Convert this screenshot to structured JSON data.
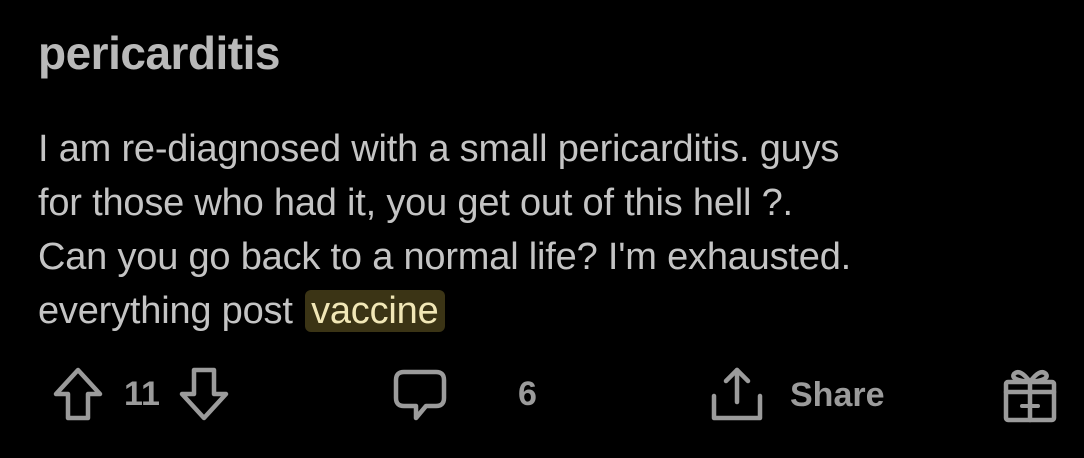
{
  "post": {
    "title": "pericarditis",
    "body_lines": [
      "I am re-diagnosed with a small pericarditis. guys",
      "for those who had it, you get out of this hell ?.",
      "Can you go back to a normal life? I'm exhausted."
    ],
    "last_line_prefix": "everything post",
    "highlighted_word": "vaccine"
  },
  "actions": {
    "upvote_icon": "arrow-up-icon",
    "vote_count": "11",
    "downvote_icon": "arrow-down-icon",
    "comment_icon": "speech-bubble-icon",
    "comment_count": "6",
    "share_icon": "share-upload-icon",
    "share_label": "Share",
    "award_icon": "gift-award-icon"
  },
  "colors": {
    "background": "#000000",
    "text": "#c4c4c4",
    "muted": "#9b9b9b",
    "highlight_bg": "#3b3415",
    "highlight_text": "#f1e7b6"
  }
}
